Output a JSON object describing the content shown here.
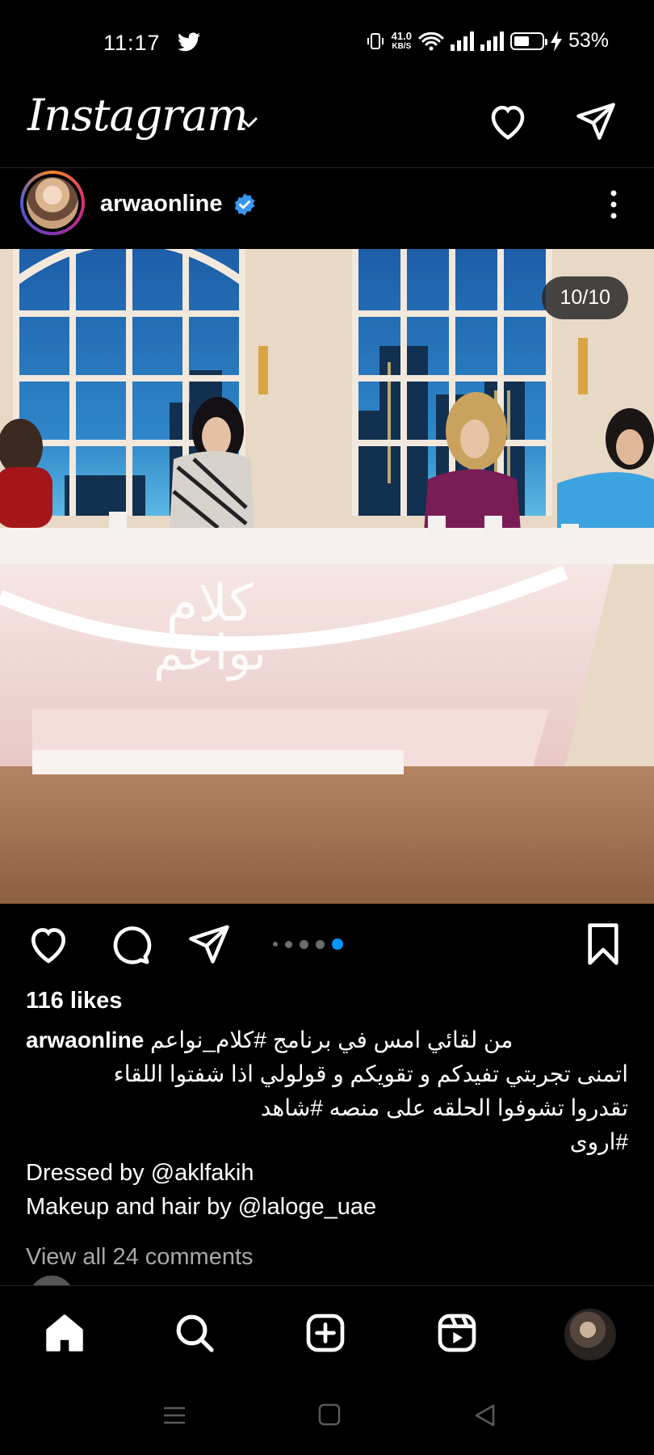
{
  "status_bar": {
    "time": "11:17",
    "net_speed_value": "41.0",
    "net_speed_unit": "KB/S",
    "battery_percent": "53%",
    "battery_level": 0.53
  },
  "app_bar": {
    "logo_text": "Instagram"
  },
  "post": {
    "username": "arwaonline",
    "image_counter": "10/10",
    "carousel": {
      "dots": 5,
      "active_index": 4
    },
    "likes": "116 likes",
    "caption": {
      "username": "arwaonline",
      "lines": [
        "من لقائي امس في برنامج #كلام_نواعم",
        "اتمنى تجربتي تفيدكم و تقويكم و قولولي اذا شفتوا اللقاء",
        "تقدروا تشوفوا الحلقه على منصه #شاهد",
        "#اروى"
      ],
      "credits": [
        "Dressed by @aklfakih",
        "Makeup and hair by @laloge_uae"
      ]
    },
    "view_comments": "View all 24 comments",
    "image_logo_text": {
      "line1": "كلام",
      "line2": "نواعم"
    }
  },
  "icons": {
    "status": [
      "twitter-icon",
      "vibrate-icon",
      "wifi-icon",
      "signal-icon",
      "signal-icon",
      "battery-icon",
      "charging-icon"
    ],
    "app_bar": [
      "chevron-down-icon",
      "heart-icon",
      "send-icon"
    ],
    "post_header": [
      "verified-icon",
      "more-icon"
    ],
    "actions": [
      "like-icon",
      "comment-icon",
      "share-icon",
      "bookmark-icon"
    ],
    "bottom_nav": [
      "home-icon",
      "search-icon",
      "create-icon",
      "reels-icon",
      "profile-avatar"
    ],
    "system_nav": [
      "menu-icon",
      "home-square-icon",
      "back-icon"
    ]
  },
  "colors": {
    "background": "#000000",
    "verified": "#3797f0",
    "active_dot": "#0095f6",
    "inactive_dot": "#6d6d6d",
    "muted_text": "#a8a8a8"
  }
}
